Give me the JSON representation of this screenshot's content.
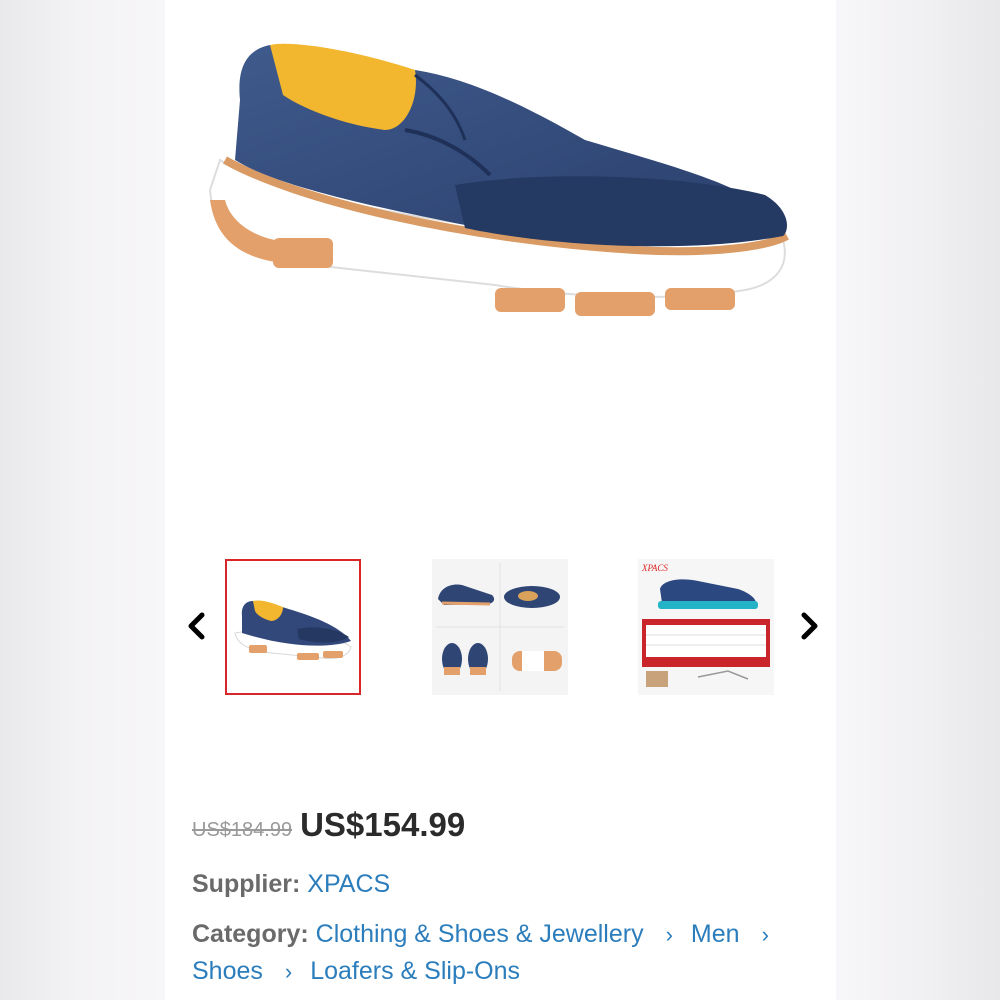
{
  "product": {
    "old_price": "US$184.99",
    "price": "US$154.99"
  },
  "supplier": {
    "label": "Supplier:",
    "name": "XPACS"
  },
  "category": {
    "label": "Category:",
    "path": [
      "Clothing & Shoes & Jewellery",
      "Men",
      "Shoes",
      "Loafers & Slip-Ons"
    ]
  },
  "gallery": {
    "thumbnails": [
      "shoe-side-view",
      "shoe-multi-angle",
      "size-chart"
    ],
    "selected_index": 0,
    "thumb3_brand": "XPACS"
  },
  "icons": {
    "prev": "chevron-left-icon",
    "next": "chevron-right-icon",
    "breadcrumb_separator": "chevron-right-icon"
  },
  "colors": {
    "link": "#2b7dbc",
    "selected_border": "#d9262a",
    "price": "#2b2b2b",
    "old_price": "#9a9a9a"
  }
}
